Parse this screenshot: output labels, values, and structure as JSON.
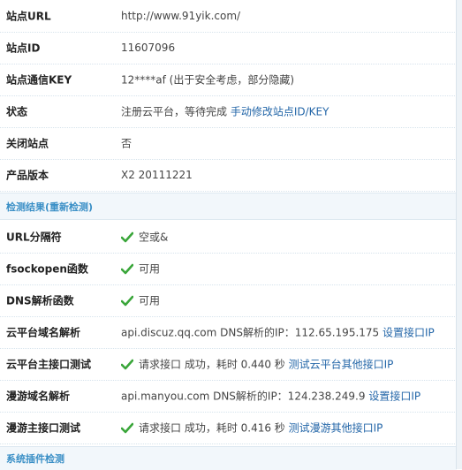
{
  "site_info": {
    "url_label": "站点URL",
    "url_value": "http://www.91yik.com/",
    "id_label": "站点ID",
    "id_value": "11607096",
    "key_label": "站点通信KEY",
    "key_value": "12****af (出于安全考虑，部分隐藏)",
    "status_label": "状态",
    "status_text": "注册云平台，等待完成",
    "status_link": "手动修改站点ID/KEY",
    "closed_label": "关闭站点",
    "closed_value": "否",
    "version_label": "产品版本",
    "version_value": "X2 20111221"
  },
  "section_check": {
    "title": "检测结果",
    "recheck": "重新检测"
  },
  "checks": {
    "url_sep_label": "URL分隔符",
    "url_sep_value": "空或&",
    "fsock_label": "fsockopen函数",
    "fsock_value": "可用",
    "dns_fn_label": "DNS解析函数",
    "dns_fn_value": "可用",
    "cloud_dns_label": "云平台域名解析",
    "cloud_dns_value": "api.discuz.qq.com DNS解析的IP：112.65.195.175",
    "cloud_dns_link": "设置接口IP",
    "cloud_api_label": "云平台主接口测试",
    "cloud_api_value": "请求接口 成功，耗时 0.440 秒",
    "cloud_api_link": "测试云平台其他接口IP",
    "roam_dns_label": "漫游域名解析",
    "roam_dns_value": "api.manyou.com DNS解析的IP：124.238.249.9",
    "roam_dns_link": "设置接口IP",
    "roam_api_label": "漫游主接口测试",
    "roam_api_value": "请求接口 成功，耗时 0.416 秒",
    "roam_api_link": "测试漫游其他接口IP"
  },
  "section_plugin": {
    "title": "系统插件检测"
  },
  "colors": {
    "link": "#2366a8",
    "section_title": "#3a8fc6",
    "check_green": "#3aa63a"
  },
  "icons": {
    "success": "check-icon"
  }
}
